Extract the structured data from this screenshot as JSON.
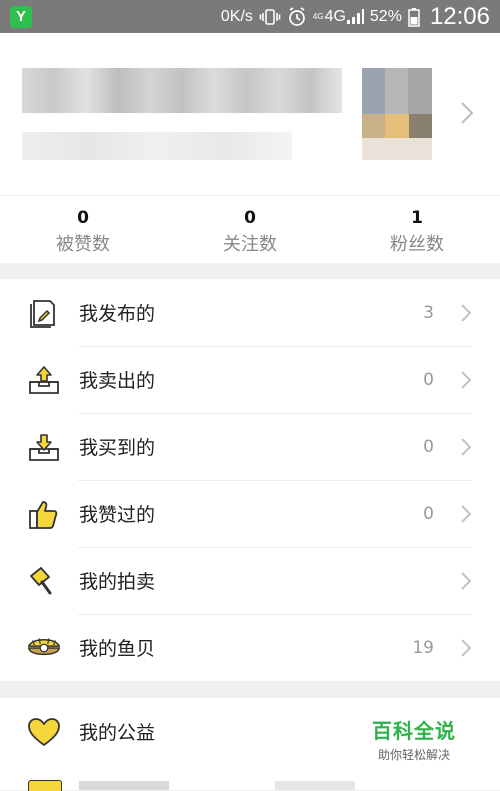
{
  "status_bar": {
    "app_badge": "Y",
    "network_speed": "0K/s",
    "signal_small": "4G",
    "signal_label": "4G",
    "battery": "52%",
    "time": "12:06"
  },
  "profile": {
    "stats": [
      {
        "value": "0",
        "label": "被赞数"
      },
      {
        "value": "0",
        "label": "关注数"
      },
      {
        "value": "1",
        "label": "粉丝数"
      }
    ]
  },
  "menu": [
    {
      "label": "我发布的",
      "count": "3",
      "icon": "document-pen-icon"
    },
    {
      "label": "我卖出的",
      "count": "0",
      "icon": "tray-upload-icon"
    },
    {
      "label": "我买到的",
      "count": "0",
      "icon": "tray-download-icon"
    },
    {
      "label": "我赞过的",
      "count": "0",
      "icon": "thumbs-up-icon"
    },
    {
      "label": "我的拍卖",
      "count": "",
      "icon": "auction-hammer-icon"
    },
    {
      "label": "我的鱼贝",
      "count": "19",
      "icon": "shell-icon"
    }
  ],
  "menu2": [
    {
      "label": "我的公益",
      "icon": "heart-icon"
    }
  ],
  "watermark": {
    "title": "百科全说",
    "subtitle": "助你轻松解决"
  },
  "colors": {
    "accent_yellow": "#f5d63d",
    "icon_stroke": "#333333",
    "watermark_green": "#2fb24a"
  }
}
